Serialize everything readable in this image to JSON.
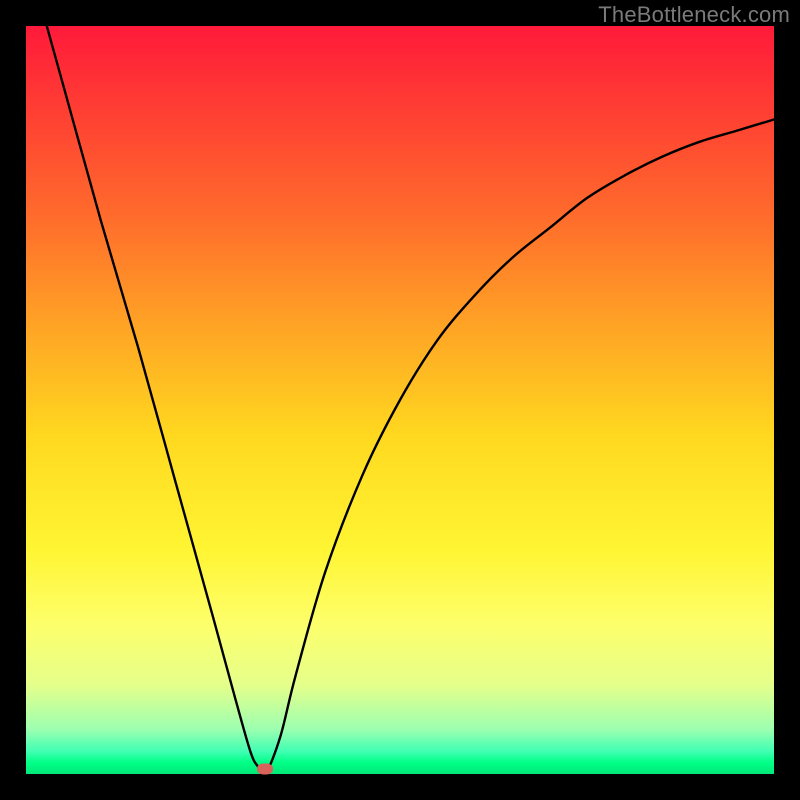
{
  "watermark": "TheBottleneck.com",
  "colors": {
    "gradient_top": "#ff1a3a",
    "gradient_bottom": "#00e878",
    "frame": "#000000",
    "curve": "#000000",
    "marker": "#d9635b"
  },
  "chart_data": {
    "type": "line",
    "title": "",
    "xlabel": "",
    "ylabel": "",
    "xlim": [
      0,
      100
    ],
    "ylim": [
      0,
      100
    ],
    "grid": false,
    "series": [
      {
        "name": "bottleneck-curve",
        "x": [
          0,
          5,
          10,
          15,
          20,
          25,
          28,
          30,
          31,
          32,
          34,
          36,
          40,
          45,
          50,
          55,
          60,
          65,
          70,
          75,
          80,
          85,
          90,
          95,
          100
        ],
        "y": [
          110,
          92,
          74,
          57,
          39,
          21,
          10,
          3,
          1,
          0,
          5,
          13,
          27,
          40,
          50,
          58,
          64,
          69,
          73,
          77,
          80,
          82.5,
          84.5,
          86,
          87.5
        ]
      }
    ],
    "annotations": [
      {
        "name": "optimal-marker",
        "x": 32,
        "y": 0.7
      }
    ]
  }
}
